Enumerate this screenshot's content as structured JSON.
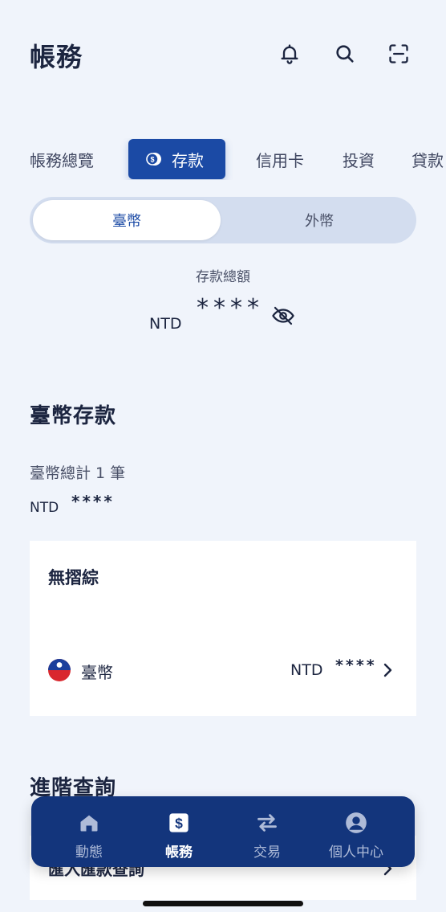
{
  "header": {
    "title": "帳務",
    "icons": [
      "bell-icon",
      "search-icon",
      "scan-icon"
    ]
  },
  "tabs": [
    {
      "label": "帳務總覽",
      "active": false
    },
    {
      "label": "存款",
      "active": true,
      "icon": "coin-icon"
    },
    {
      "label": "信用卡",
      "active": false
    },
    {
      "label": "投資",
      "active": false
    },
    {
      "label": "貸款",
      "active": false
    }
  ],
  "segment": {
    "selected": "臺幣",
    "other": "外幣"
  },
  "summary": {
    "label": "存款總額",
    "currency": "NTD",
    "amount": "****"
  },
  "section": {
    "title": "臺幣存款",
    "count_text": "臺幣總計 1 筆",
    "currency": "NTD",
    "amount": "****"
  },
  "account_card": {
    "title": "無摺綜",
    "account_label": "臺幣",
    "currency": "NTD",
    "amount": "****"
  },
  "advanced": {
    "title": "進階查詢",
    "item_label": "匯入匯款查詢"
  },
  "bottom_nav": [
    {
      "label": "動態",
      "icon": "home-icon",
      "active": false
    },
    {
      "label": "帳務",
      "icon": "dollar-icon",
      "active": true
    },
    {
      "label": "交易",
      "icon": "transfer-icon",
      "active": false
    },
    {
      "label": "個人中心",
      "icon": "person-icon",
      "active": false
    }
  ],
  "colors": {
    "background": "#f0f4fb",
    "primary": "#1b4aa5",
    "nav_bg": "#13357c",
    "segment_bg": "#d3ddef"
  }
}
